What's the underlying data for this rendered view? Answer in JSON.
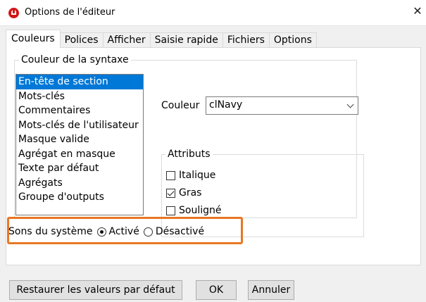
{
  "window": {
    "title": "Options de l'éditeur",
    "close_glyph": "✕"
  },
  "tabs": [
    {
      "label": "Couleurs",
      "active": true
    },
    {
      "label": "Polices",
      "active": false
    },
    {
      "label": "Afficher",
      "active": false
    },
    {
      "label": "Saisie rapide",
      "active": false
    },
    {
      "label": "Fichiers",
      "active": false
    },
    {
      "label": "Options",
      "active": false
    }
  ],
  "syntax_group": {
    "legend": "Couleur de la syntaxe",
    "items": [
      "En-tête de section",
      "Mots-clés",
      "Commentaires",
      "Mots-clés de l'utilisateur",
      "Masque valide",
      "Agrégat en masque",
      "Texte par défaut",
      "Agrégats",
      "Groupe d'outputs"
    ],
    "selected_index": 0,
    "color_label": "Couleur",
    "color_value": "clNavy"
  },
  "attributes": {
    "legend": "Attributs",
    "items": [
      {
        "label": "Italique",
        "checked": false
      },
      {
        "label": "Gras",
        "checked": true
      },
      {
        "label": "Souligné",
        "checked": false
      }
    ]
  },
  "sounds": {
    "label": "Sons du système",
    "options": [
      {
        "label": "Activé",
        "selected": true
      },
      {
        "label": "Désactivé",
        "selected": false
      }
    ]
  },
  "highlight_color": "#e87722",
  "selection_color": "#0078d7",
  "buttons": {
    "restore": "Restaurer les valeurs par défaut",
    "ok": "OK",
    "cancel": "Annuler"
  }
}
